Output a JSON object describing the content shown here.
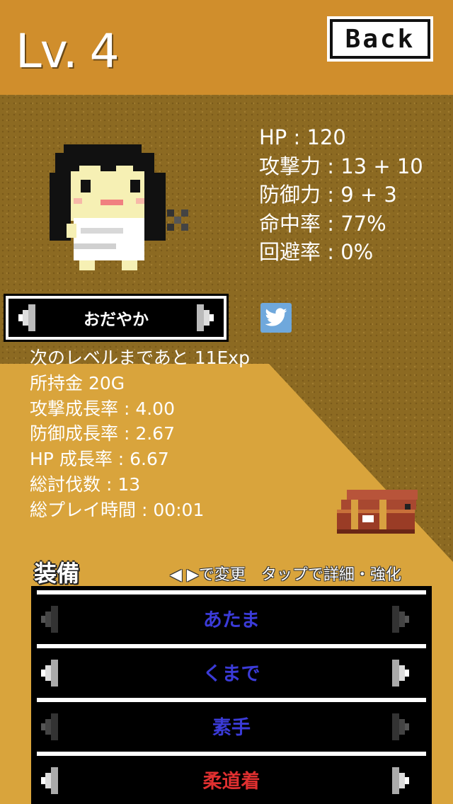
{
  "header": {
    "level": "Lv. 4",
    "back_label": "Back"
  },
  "stats": [
    "HP : 120",
    "攻撃力 : 13 + 10",
    "防御力 : 9 + 3",
    "命中率 : 77%",
    "回避率 : 0%"
  ],
  "personality": {
    "label": "おだやか"
  },
  "info": [
    "次のレベルまであと 11Exp",
    "所持金 20G",
    "攻撃成長率 : 4.00",
    "防御成長率 : 2.67",
    "HP 成長率 : 6.67",
    "総討伐数 : 13",
    "総プレイ時間 : 00:01"
  ],
  "equipment": {
    "title": "装備",
    "hint": "◀ ▶で変更　タップで詳細・強化",
    "slots": [
      {
        "name": "あたま",
        "color": "#3b3bd8",
        "arrows_active": false
      },
      {
        "name": "くまで",
        "color": "#3b3bd8",
        "arrows_active": true
      },
      {
        "name": "素手",
        "color": "#3b3bd8",
        "arrows_active": false
      },
      {
        "name": "柔道着",
        "color": "#e03030",
        "arrows_active": true
      }
    ]
  },
  "icons": {
    "twitter": "twitter-icon",
    "chest": "treasure-chest-icon",
    "left": "arrow-left-icon",
    "right": "arrow-right-icon"
  },
  "colors": {
    "header_bg": "#d08e2c",
    "sand": "#d9a43c",
    "dirt": "#8c6a22"
  }
}
